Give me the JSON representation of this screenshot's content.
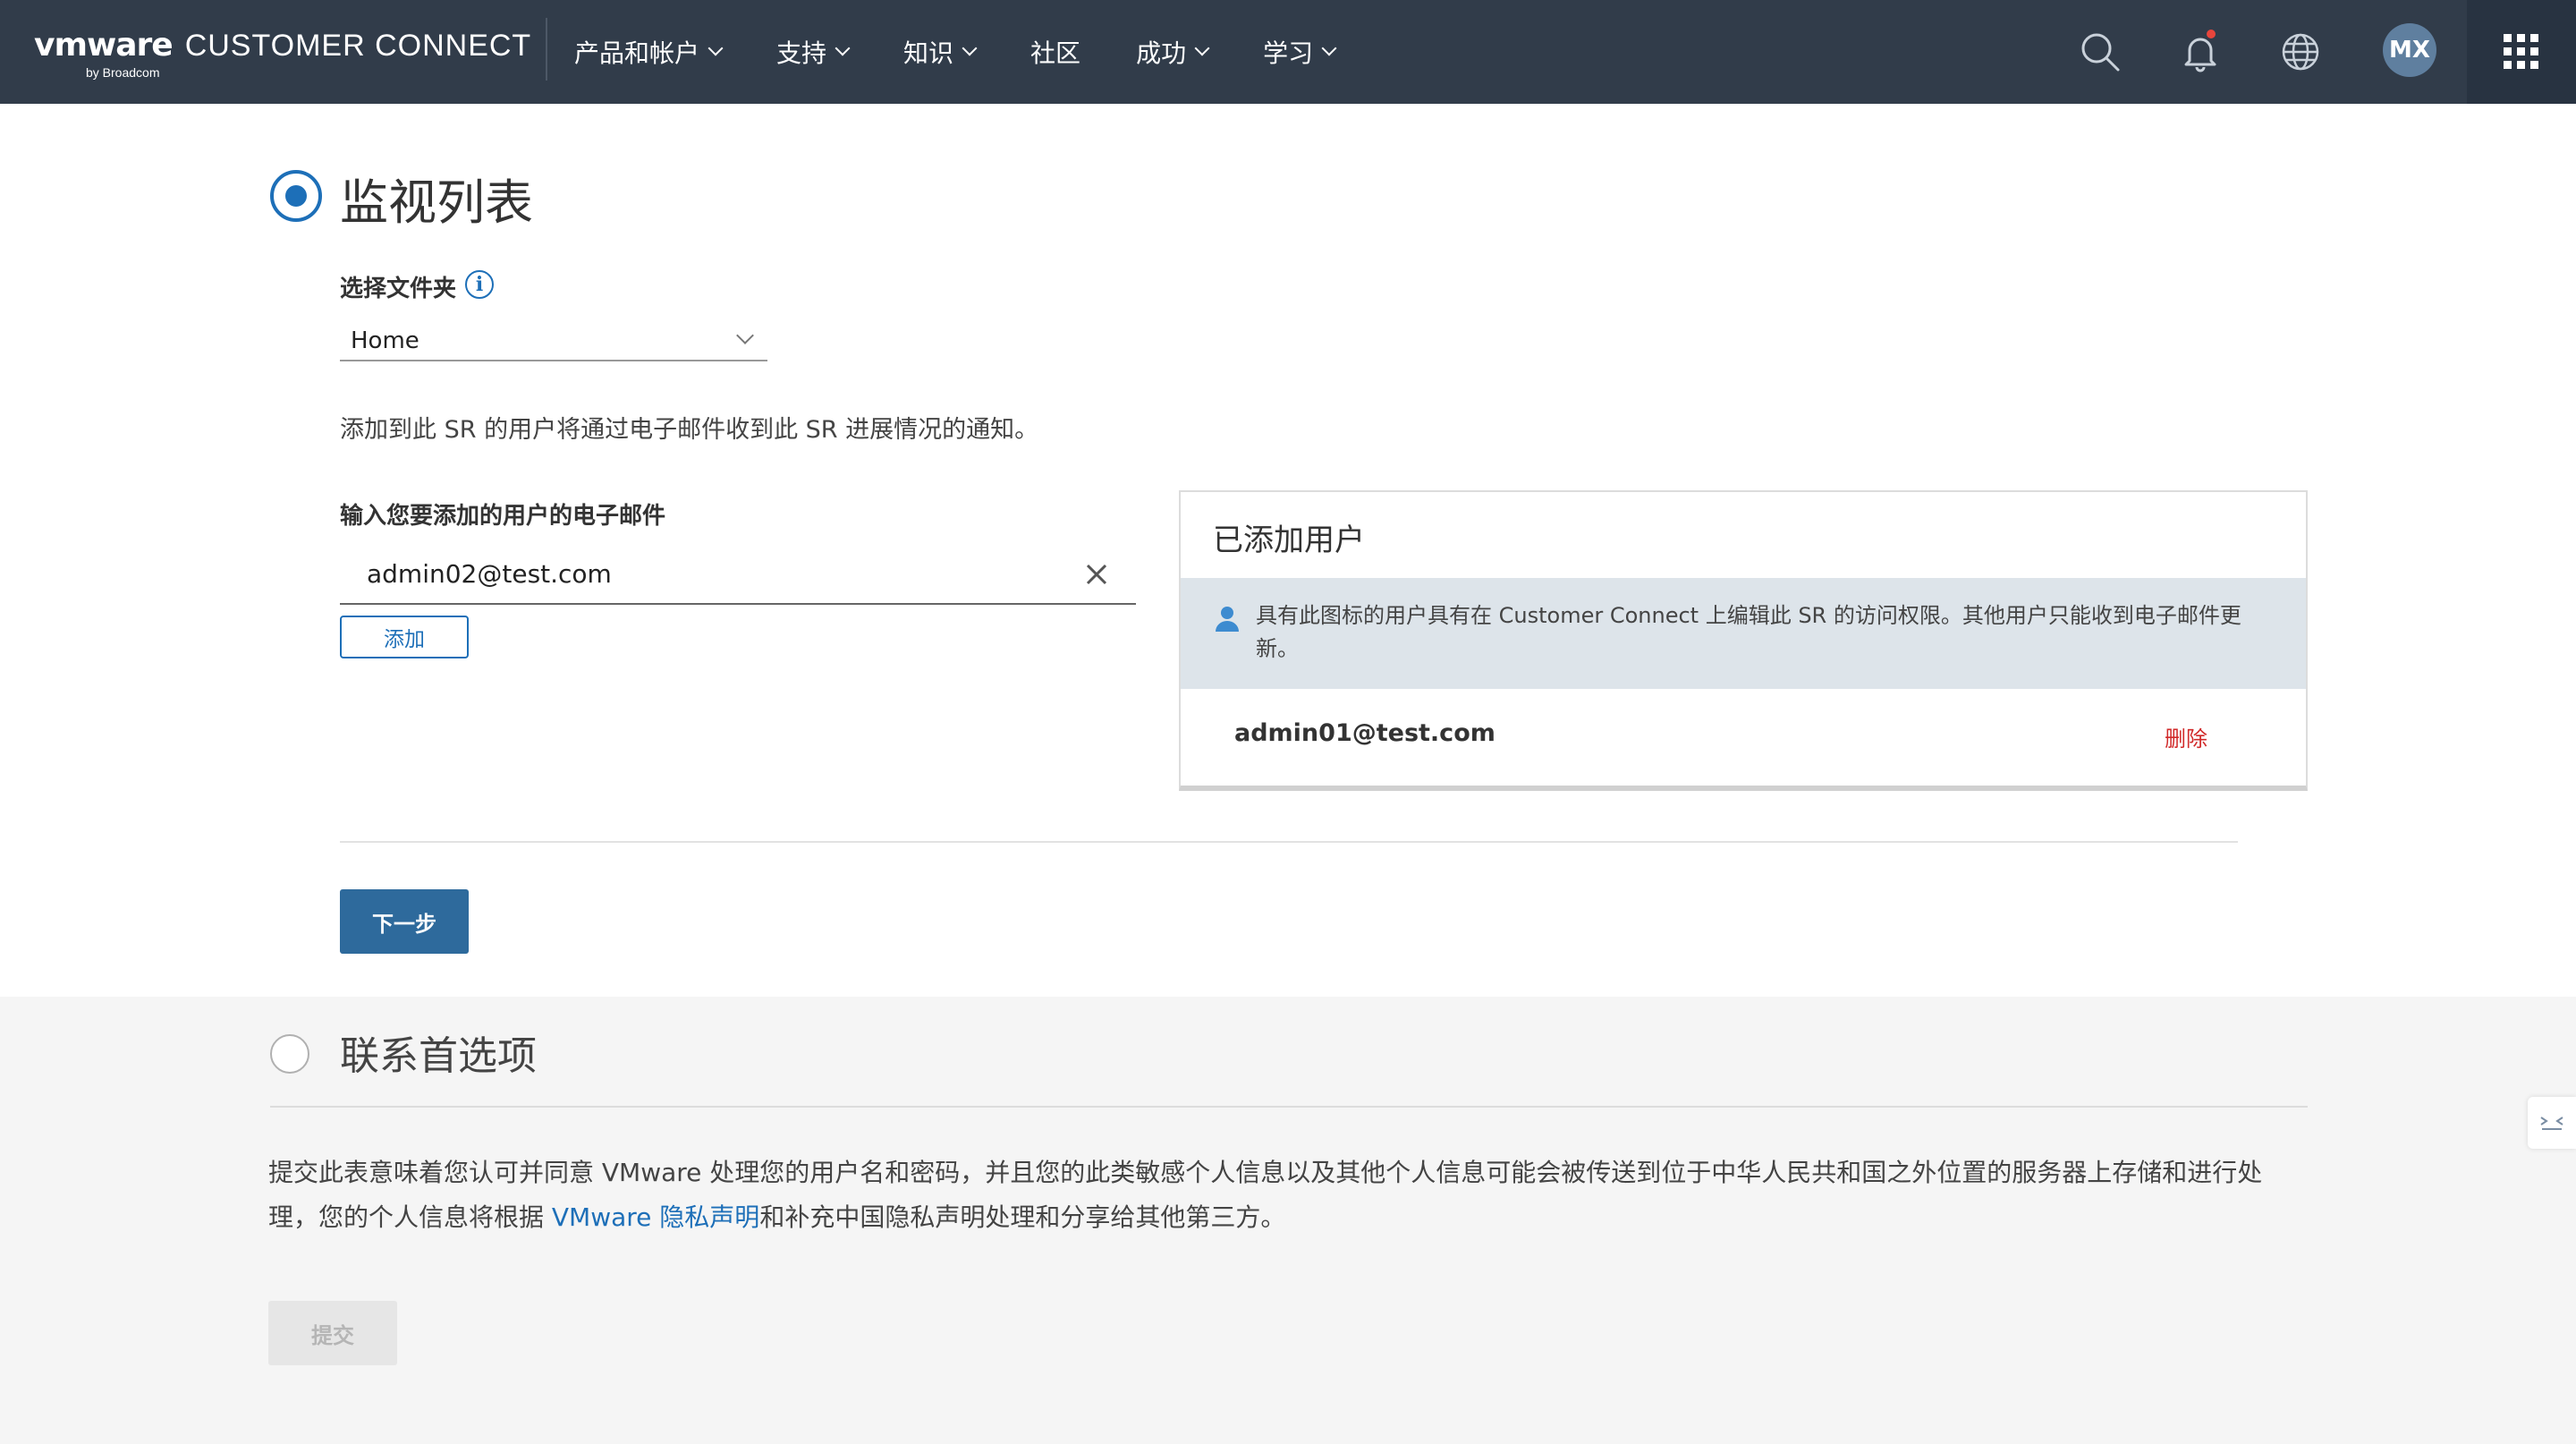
{
  "header": {
    "logo_vmware": "vmware",
    "logo_product": "CUSTOMER CONNECT",
    "logo_by": "by Broadcom",
    "nav": [
      {
        "label": "产品和帐户",
        "dropdown": true
      },
      {
        "label": "支持",
        "dropdown": true
      },
      {
        "label": "知识",
        "dropdown": true
      },
      {
        "label": "社区",
        "dropdown": false
      },
      {
        "label": "成功",
        "dropdown": true
      },
      {
        "label": "学习",
        "dropdown": true
      }
    ],
    "icons": [
      "search-icon",
      "bell-icon",
      "globe-icon",
      "apps-grid-icon"
    ],
    "notification_dot_color": "#e8453c",
    "avatar_initials": "MX",
    "bg_color": "#313c4a"
  },
  "watchlist": {
    "title": "监视列表",
    "folder_label": "选择文件夹",
    "folder_value": "Home",
    "description": "添加到此 SR 的用户将通过电子邮件收到此 SR 进展情况的通知。",
    "email_label": "输入您要添加的用户的电子邮件",
    "email_value": "admin02@test.com",
    "add_button": "添加",
    "added_users": {
      "title": "已添加用户",
      "note": "具有此图标的用户具有在 Customer Connect 上编辑此 SR 的访问权限。其他用户只能收到电子邮件更新。",
      "users": [
        {
          "email": "admin01@test.com",
          "action": "删除"
        }
      ]
    },
    "next_button": "下一步"
  },
  "contact": {
    "title": "联系首选项",
    "consent_before": "提交此表意味着您认可并同意 VMware 处理您的用户名和密码，并且您的此类敏感个人信息以及其他个人信息可能会被传送到位于中华人民共和国之外位置的服务器上存储和进行处理，您的个人信息将根据 ",
    "consent_link": "VMware 隐私声明",
    "consent_after": "和补充中国隐私声明处理和分享给其他第三方。",
    "submit_button": "提交"
  },
  "colors": {
    "accent": "#1d6fb8",
    "primary_button": "#2e6a9c",
    "delete": "#d12a2a",
    "note_bg": "#dde4ea"
  }
}
